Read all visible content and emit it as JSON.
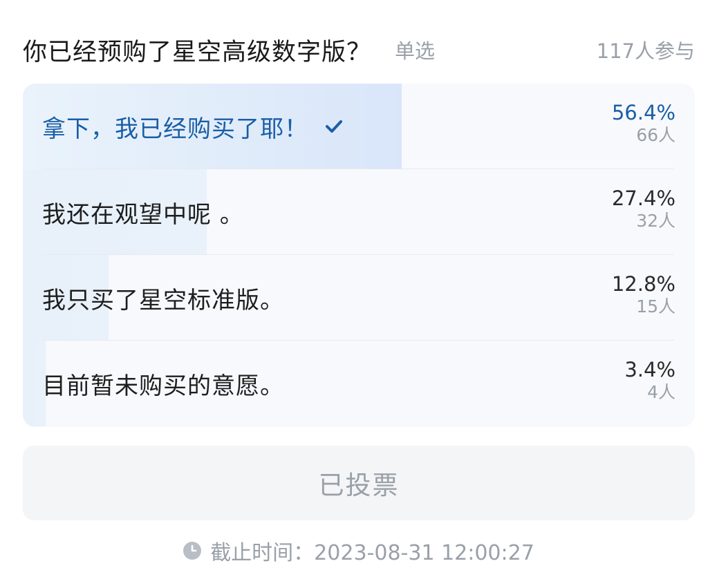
{
  "poll": {
    "question": "你已经预购了星空高级数字版？",
    "type": "单选",
    "participants": "117人参与",
    "options": [
      {
        "label": "拿下，我已经购买了耶！",
        "percent": "56.4%",
        "count": "66人",
        "share": 0.564,
        "selected": true
      },
      {
        "label": "我还在观望中呢 。",
        "percent": "27.4%",
        "count": "32人",
        "share": 0.274,
        "selected": false
      },
      {
        "label": "我只买了星空标准版。",
        "percent": "12.8%",
        "count": "15人",
        "share": 0.128,
        "selected": false
      },
      {
        "label": "目前暂未购买的意愿。",
        "percent": "3.4%",
        "count": "4人",
        "share": 0.034,
        "selected": false
      }
    ],
    "vote_button": "已投票",
    "deadline": "截止时间：2023-08-31 12:00:27"
  },
  "icons": {
    "selected": "check-icon",
    "deadline": "clock-icon"
  },
  "colors": {
    "accent": "#1a5ea6",
    "muted": "#9aa0a8",
    "fill": "#d9e6fa"
  }
}
